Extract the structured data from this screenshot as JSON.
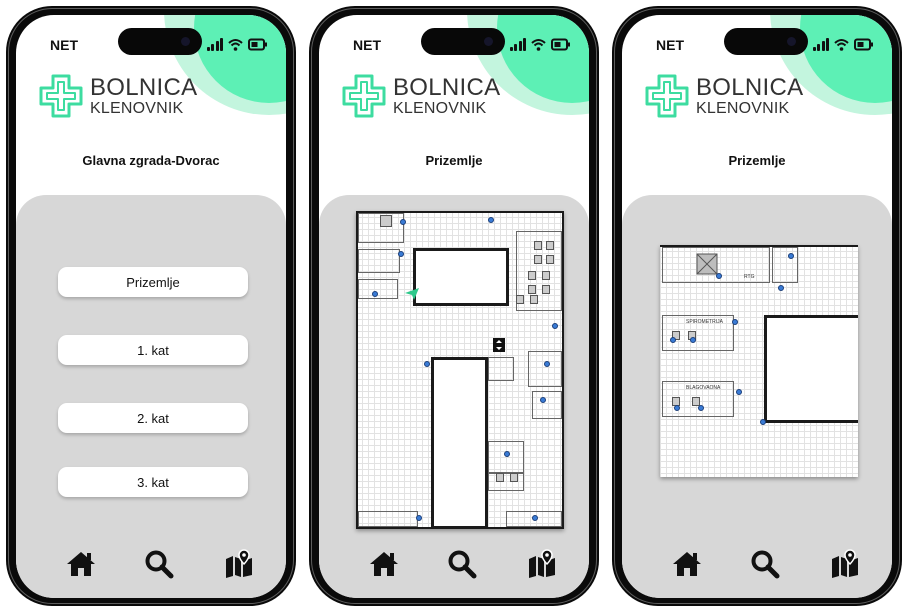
{
  "brand": {
    "line1": "BOLNICA",
    "line2": "KLENOVNIK",
    "accent": "#5df0b5",
    "accent_light": "#c3f5de"
  },
  "status_bar": {
    "carrier": "NET",
    "icons": [
      "signal-icon",
      "wifi-icon",
      "battery-icon"
    ]
  },
  "nav_icons": [
    "home-icon",
    "search-icon",
    "map-icon"
  ],
  "screens": [
    {
      "title": "Glavna zgrada-Dvorac",
      "floors": [
        "Prizemlje",
        "1. kat",
        "2. kat",
        "3. kat"
      ]
    },
    {
      "title": "Prizemlje"
    },
    {
      "title": "Prizemlje",
      "map_labels": [
        "RTG",
        "SPIROMETRIJA",
        "BLAGOVAONA"
      ]
    }
  ]
}
